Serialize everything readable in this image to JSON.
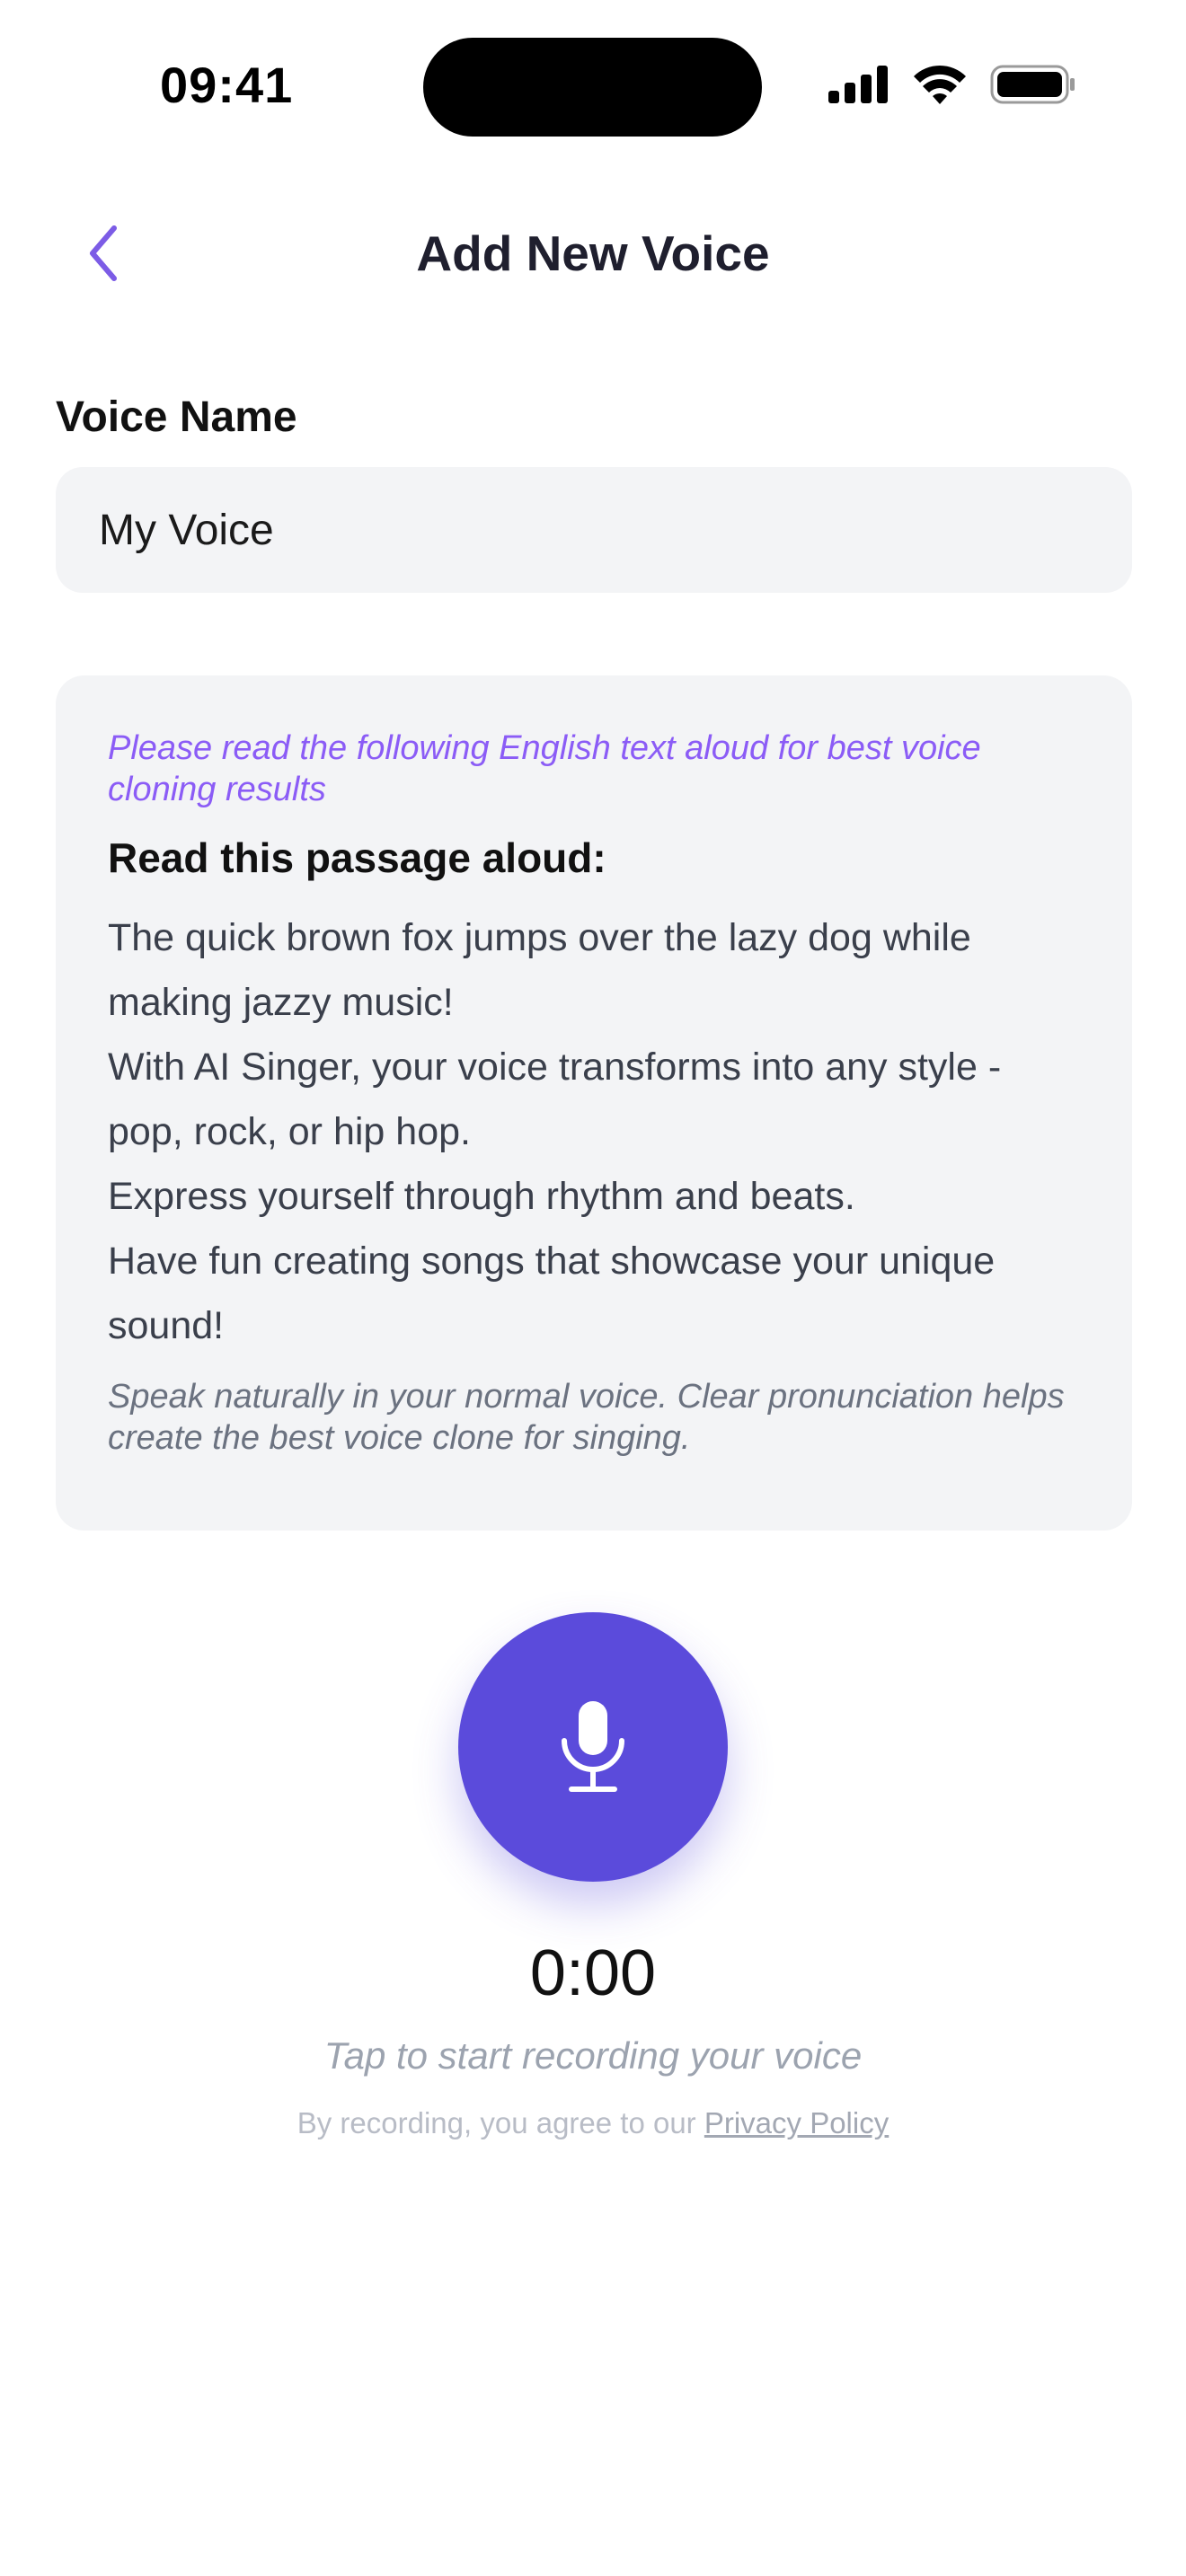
{
  "status_bar": {
    "time": "09:41"
  },
  "nav": {
    "title": "Add New Voice"
  },
  "form": {
    "voice_name_label": "Voice Name",
    "voice_name_value": "My Voice"
  },
  "passage_card": {
    "hint": "Please read the following English text aloud for best voice cloning results",
    "heading": "Read this passage aloud:",
    "lines": [
      "The quick brown fox jumps over the lazy dog while making jazzy music!",
      "With AI Singer, your voice transforms into any style - pop, rock, or hip hop.",
      "Express yourself through rhythm and beats.",
      "Have fun creating songs that showcase your unique sound!"
    ],
    "note": "Speak naturally in your normal voice. Clear pronunciation helps create the best voice clone for singing."
  },
  "recorder": {
    "timer": "0:00",
    "hint": "Tap to start recording your voice",
    "agree_text": "By recording, you agree to our",
    "privacy_link": "Privacy Policy"
  },
  "colors": {
    "accent": "#5b4bdb",
    "hint_purple": "#8b5cf6",
    "card_bg": "#f3f4f6"
  },
  "icons": {
    "back": "chevron-left-icon",
    "record": "microphone-icon",
    "signal": "cellular-signal-icon",
    "wifi": "wifi-icon",
    "battery": "battery-icon"
  }
}
